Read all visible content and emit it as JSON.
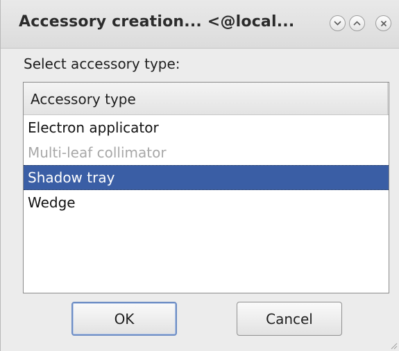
{
  "window": {
    "title": "Accessory creation... <@local...",
    "buttons": {
      "minimize_icon": "chevron-down-icon",
      "maximize_icon": "chevron-up-icon",
      "close_icon": "close-icon"
    }
  },
  "prompt": "Select accessory type:",
  "list": {
    "header": "Accessory type",
    "items": [
      {
        "label": "Electron applicator",
        "state": "normal"
      },
      {
        "label": "Multi-leaf collimator",
        "state": "disabled"
      },
      {
        "label": "Shadow tray",
        "state": "selected"
      },
      {
        "label": "Wedge",
        "state": "normal"
      }
    ]
  },
  "buttons": {
    "ok": "OK",
    "cancel": "Cancel"
  },
  "colors": {
    "selection": "#3a5ea5",
    "disabled_text": "#a8a8a8",
    "default_button_border": "#6d8dc4"
  }
}
